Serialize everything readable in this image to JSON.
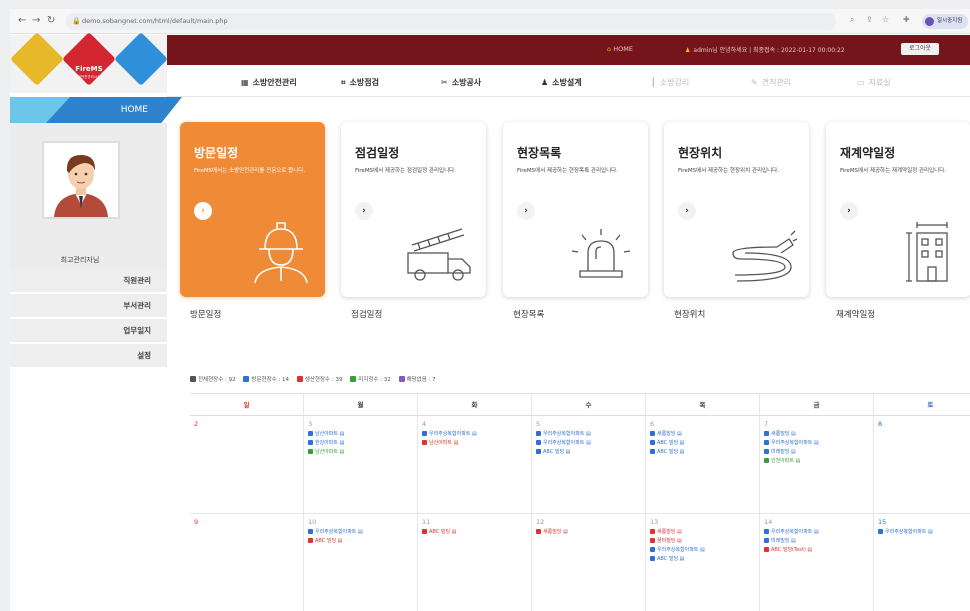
{
  "browser": {
    "url": "demo.sobangnet.com/html/default/main.php",
    "profile_label": "일시중지됨"
  },
  "logo": {
    "name": "FireMS",
    "tagline": "소방안전관리시스템"
  },
  "topbar": {
    "home": "HOME",
    "user": "admin님 안녕하세요 | 최종접속 : 2022-01-17 00:00:22",
    "logout": "로그아웃"
  },
  "menu": [
    {
      "label": "소방안전관리",
      "icon": "building-icon",
      "enabled": true
    },
    {
      "label": "소방점검",
      "icon": "clipboard-icon",
      "enabled": true
    },
    {
      "label": "소방공사",
      "icon": "tools-icon",
      "enabled": true
    },
    {
      "label": "소방설계",
      "icon": "person-icon",
      "enabled": true
    },
    {
      "label": "소방감리",
      "icon": "pin-icon",
      "enabled": false
    },
    {
      "label": "견적관리",
      "icon": "edit-icon",
      "enabled": false
    },
    {
      "label": "자료실",
      "icon": "folder-icon",
      "enabled": false
    }
  ],
  "sidebar": {
    "home": "HOME",
    "username": "최고관리자님",
    "items": [
      "직원관리",
      "부서관리",
      "업무일지",
      "설정"
    ]
  },
  "cards": [
    {
      "title": "방문일정",
      "desc": "FireMS에서는 소방안전관리를 전문으로 합니다.",
      "label": "방문일정",
      "icon": "firefighter-icon"
    },
    {
      "title": "점검일정",
      "desc": "FireMS에서 제공하는 점검일정 관리입니다.",
      "label": "점검일정",
      "icon": "firetruck-icon"
    },
    {
      "title": "현장목록",
      "desc": "FireMS에서 제공하는 현장목록 관리입니다.",
      "label": "현장목록",
      "icon": "siren-icon"
    },
    {
      "title": "현장위치",
      "desc": "FireMS에서 제공하는 현장위치 관리입니다.",
      "label": "현장위치",
      "icon": "hose-icon"
    },
    {
      "title": "재계약일정",
      "desc": "FireMS에서 제공하는 재계약일정 관리입니다.",
      "label": "재계약일정",
      "icon": "building-icon"
    }
  ],
  "legend": [
    {
      "label": "전체현장수 : 92",
      "color": "#555555"
    },
    {
      "label": "방문현장수 : 14",
      "color": "#2f6fd6"
    },
    {
      "label": "생산현장수 : 39",
      "color": "#d33333"
    },
    {
      "label": "미지정수 : 32",
      "color": "#3a9d3a"
    },
    {
      "label": "해당없음 : 7",
      "color": "#8b55c2"
    }
  ],
  "calendar": {
    "days": [
      "일",
      "월",
      "화",
      "수",
      "목",
      "금",
      "토"
    ],
    "weeks": [
      [
        {
          "day": "2",
          "events": []
        },
        {
          "day": "3",
          "events": [
            {
              "t": "남산아파트",
              "c": "blue"
            },
            {
              "t": "한강아파트",
              "c": "blue"
            },
            {
              "t": "남산아파트",
              "c": "green"
            }
          ]
        },
        {
          "day": "4",
          "events": [
            {
              "t": "우리주상복합아파트",
              "c": "blue"
            },
            {
              "t": "남산아파트",
              "c": "red"
            }
          ]
        },
        {
          "day": "5",
          "events": [
            {
              "t": "우리주상복합아파트",
              "c": "blue"
            },
            {
              "t": "우리주상복합아파트",
              "c": "blue"
            },
            {
              "t": "ABC 빌딩",
              "c": "blue"
            }
          ]
        },
        {
          "day": "6",
          "events": [
            {
              "t": "새롬빌딩",
              "c": "blue"
            },
            {
              "t": "ABC 빌딩",
              "c": "blue"
            },
            {
              "t": "ABC 빌딩",
              "c": "blue"
            }
          ]
        },
        {
          "day": "7",
          "events": [
            {
              "t": "새롬빌딩",
              "c": "blue"
            },
            {
              "t": "우리주상복합아파트",
              "c": "blue"
            },
            {
              "t": "미래빌딩",
              "c": "blue"
            },
            {
              "t": "인천아파트",
              "c": "green"
            }
          ]
        },
        {
          "day": "8",
          "events": []
        }
      ],
      [
        {
          "day": "9",
          "events": []
        },
        {
          "day": "10",
          "events": [
            {
              "t": "우리주상복합아파트",
              "c": "blue"
            },
            {
              "t": "ABC 빌딩",
              "c": "red"
            }
          ]
        },
        {
          "day": "11",
          "events": [
            {
              "t": "ABC 빌딩",
              "c": "red"
            }
          ]
        },
        {
          "day": "12",
          "events": [
            {
              "t": "새롬빌딩",
              "c": "red"
            }
          ]
        },
        {
          "day": "13",
          "events": [
            {
              "t": "새롬빌딩",
              "c": "red"
            },
            {
              "t": "꿈미빌딩",
              "c": "red"
            },
            {
              "t": "우리주상복합아파트",
              "c": "blue"
            },
            {
              "t": "ABC 빌딩",
              "c": "blue"
            }
          ]
        },
        {
          "day": "14",
          "events": [
            {
              "t": "우리주상복합아파트",
              "c": "blue"
            },
            {
              "t": "미래빌딩",
              "c": "blue"
            },
            {
              "t": "ABC 빌딩(Test)",
              "c": "red"
            }
          ]
        },
        {
          "day": "15",
          "events": [
            {
              "t": "우리주상복합아파트",
              "c": "blue"
            }
          ]
        }
      ]
    ]
  }
}
